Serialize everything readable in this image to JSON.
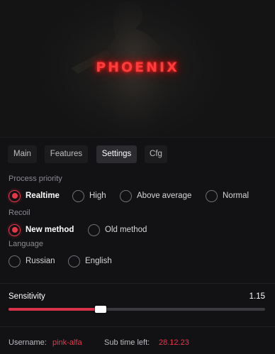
{
  "banner": {
    "logo_text": "PHOENIX",
    "accent": "#ff3b3b"
  },
  "tabs": [
    {
      "label": "Main",
      "active": false
    },
    {
      "label": "Features",
      "active": false
    },
    {
      "label": "Settings",
      "active": true
    },
    {
      "label": "Cfg",
      "active": false
    }
  ],
  "settings": {
    "process_priority": {
      "title": "Process priority",
      "options": [
        "Realtime",
        "High",
        "Above average",
        "Normal"
      ],
      "selected": "Realtime"
    },
    "recoil": {
      "title": "Recoil",
      "options": [
        "New method",
        "Old method"
      ],
      "selected": "New method"
    },
    "language": {
      "title": "Language",
      "options": [
        "Russian",
        "English"
      ],
      "selected": null
    },
    "sensitivity": {
      "label": "Sensitivity",
      "value": "1.15",
      "fill_fraction": 0.36
    }
  },
  "footer": {
    "username_label": "Username:",
    "username": "pink-alfa",
    "sub_label": "Sub time left:",
    "sub_value": "28.12.23"
  },
  "colors": {
    "accent": "#e8354a",
    "background": "#121214"
  }
}
